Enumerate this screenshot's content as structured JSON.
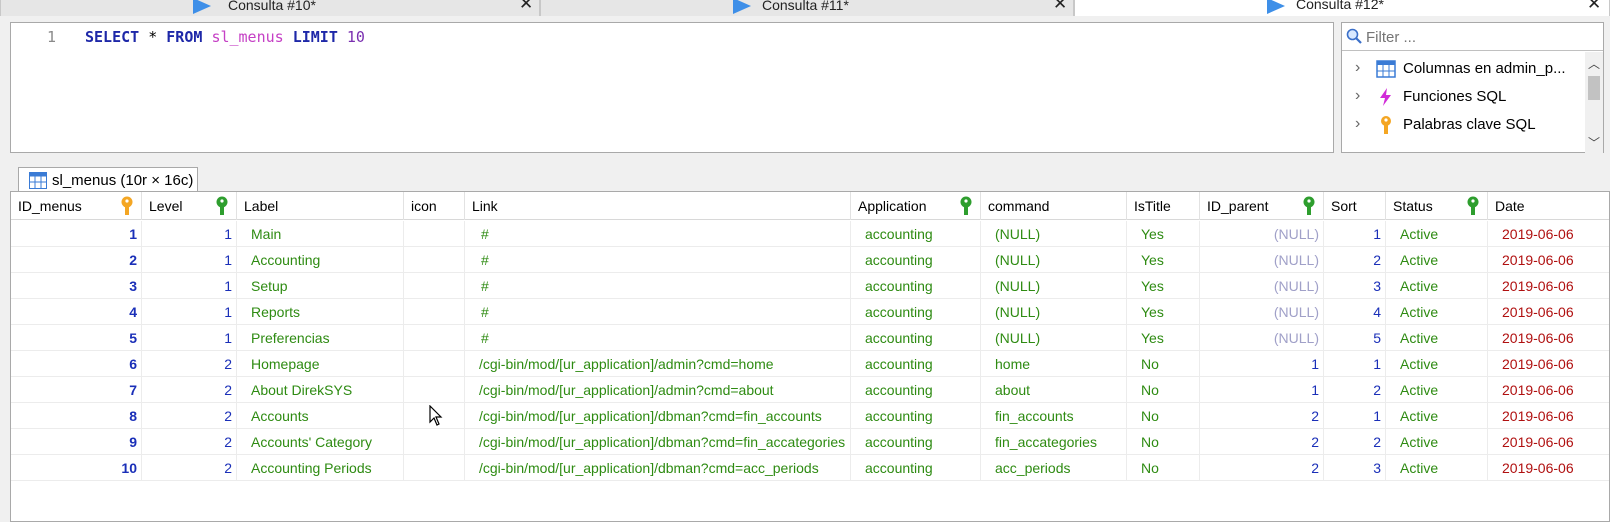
{
  "tabs": [
    {
      "label": "Consulta #10*",
      "close": "✕"
    },
    {
      "label": "Consulta #11*",
      "close": "✕"
    },
    {
      "label": "Consulta #12*",
      "close": "✕"
    }
  ],
  "editor": {
    "line_number": "1",
    "tokens": {
      "select": "SELECT",
      "star": " * ",
      "from": "FROM",
      "table": "sl_menus",
      "limit": "LIMIT",
      "num": "10"
    }
  },
  "helper": {
    "filter_placeholder": "Filter ...",
    "items": [
      {
        "label": "Columnas en admin_p...",
        "icon": "table-icon"
      },
      {
        "label": "Funciones SQL",
        "icon": "lightning-icon"
      },
      {
        "label": "Palabras clave SQL",
        "icon": "key-icon"
      }
    ]
  },
  "result_tab": {
    "label": "sl_menus (10r × 16c)"
  },
  "grid": {
    "columns": [
      "ID_menus",
      "Level",
      "Label",
      "icon",
      "Link",
      "Application",
      "command",
      "IsTitle",
      "ID_parent",
      "Sort",
      "Status",
      "Date"
    ],
    "rows": [
      [
        "1",
        "1",
        "Main",
        "",
        "#",
        "accounting",
        "(NULL)",
        "Yes",
        "(NULL)",
        "1",
        "Active",
        "2019-06-06"
      ],
      [
        "2",
        "1",
        "Accounting",
        "",
        "#",
        "accounting",
        "(NULL)",
        "Yes",
        "(NULL)",
        "2",
        "Active",
        "2019-06-06"
      ],
      [
        "3",
        "1",
        "Setup",
        "",
        "#",
        "accounting",
        "(NULL)",
        "Yes",
        "(NULL)",
        "3",
        "Active",
        "2019-06-06"
      ],
      [
        "4",
        "1",
        "Reports",
        "",
        "#",
        "accounting",
        "(NULL)",
        "Yes",
        "(NULL)",
        "4",
        "Active",
        "2019-06-06"
      ],
      [
        "5",
        "1",
        "Preferencias",
        "",
        "#",
        "accounting",
        "(NULL)",
        "Yes",
        "(NULL)",
        "5",
        "Active",
        "2019-06-06"
      ],
      [
        "6",
        "2",
        "Homepage",
        "",
        "/cgi-bin/mod/[ur_application]/admin?cmd=home",
        "accounting",
        "home",
        "No",
        "1",
        "1",
        "Active",
        "2019-06-06"
      ],
      [
        "7",
        "2",
        "About DirekSYS",
        "",
        "/cgi-bin/mod/[ur_application]/admin?cmd=about",
        "accounting",
        "about",
        "No",
        "1",
        "2",
        "Active",
        "2019-06-06"
      ],
      [
        "8",
        "2",
        "Accounts",
        "",
        "/cgi-bin/mod/[ur_application]/dbman?cmd=fin_accounts",
        "accounting",
        "fin_accounts",
        "No",
        "2",
        "1",
        "Active",
        "2019-06-06"
      ],
      [
        "9",
        "2",
        "Accounts' Category",
        "",
        "/cgi-bin/mod/[ur_application]/dbman?cmd=fin_accategories",
        "accounting",
        "fin_accategories",
        "No",
        "2",
        "2",
        "Active",
        "2019-06-06"
      ],
      [
        "10",
        "2",
        "Accounting Periods",
        "",
        "/cgi-bin/mod/[ur_application]/dbman?cmd=acc_periods",
        "accounting",
        "acc_periods",
        "No",
        "2",
        "3",
        "Active",
        "2019-06-06"
      ]
    ]
  }
}
